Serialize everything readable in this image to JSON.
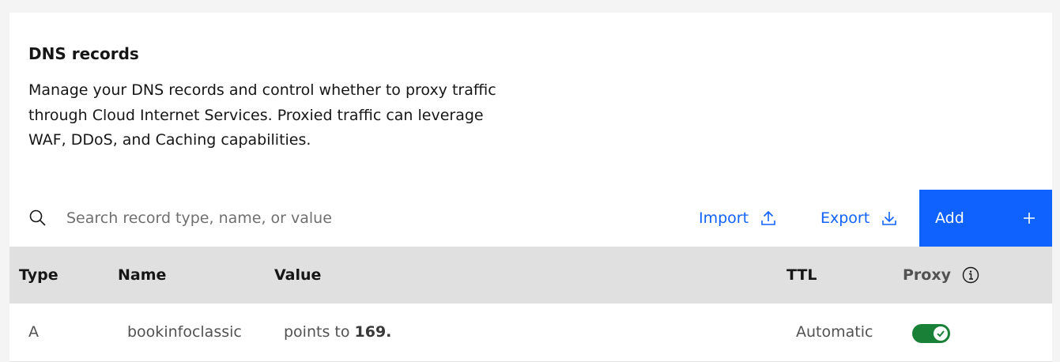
{
  "header": {
    "title": "DNS records",
    "description": "Manage your DNS records and control whether to proxy traffic through Cloud Internet Services. Proxied traffic can leverage WAF, DDoS, and Caching capabilities."
  },
  "toolbar": {
    "search_placeholder": "Search record type, name, or value",
    "search_value": "",
    "import_label": "Import",
    "export_label": "Export",
    "add_label": "Add"
  },
  "table": {
    "columns": [
      "Type",
      "Name",
      "Value",
      "TTL",
      "Proxy"
    ],
    "rows": [
      {
        "type": "A",
        "name": "bookinfoclassic",
        "value_prefix": "points to ",
        "value_strong": "169.",
        "ttl": "Automatic",
        "proxy": true
      }
    ]
  },
  "colors": {
    "primary": "#0f62fe",
    "toggle_on": "#198038",
    "header_bg": "#e0e0e0"
  },
  "icons": [
    "search-icon",
    "upload-icon",
    "download-icon",
    "plus-icon",
    "info-icon",
    "checkmark-icon"
  ]
}
